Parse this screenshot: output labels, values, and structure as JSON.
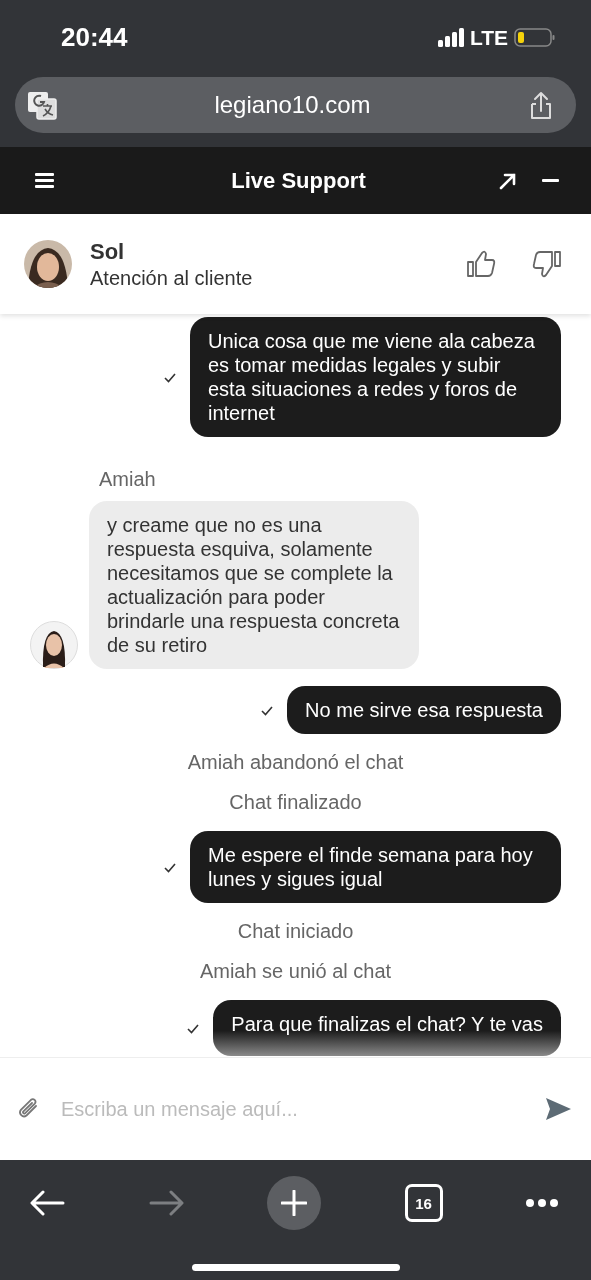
{
  "status_bar": {
    "time": "20:44",
    "network": "LTE"
  },
  "browser": {
    "url": "legiano10.com"
  },
  "chat_header": {
    "title": "Live Support"
  },
  "agent": {
    "name": "Sol",
    "role": "Atención al cliente"
  },
  "messages": [
    {
      "kind": "sent",
      "text": "Unica cosa que me viene ala cabeza es tomar medidas legales y subir esta situaciones a redes y foros de internet"
    },
    {
      "kind": "received",
      "sender": "Amiah",
      "text": "y creame que no es una respuesta esquiva, solamente necesitamos que se complete la actualización para poder brindarle una respuesta concreta de su retiro"
    },
    {
      "kind": "sent",
      "text": "No me sirve esa respuesta"
    },
    {
      "kind": "system",
      "text": "Amiah abandonó el chat"
    },
    {
      "kind": "system",
      "text": "Chat finalizado"
    },
    {
      "kind": "sent",
      "text": "Me espere el finde semana para hoy lunes y sigues igual"
    },
    {
      "kind": "system",
      "text": "Chat iniciado"
    },
    {
      "kind": "system",
      "text": "Amiah se unió al chat"
    },
    {
      "kind": "sent",
      "text": "Para que finalizas el chat? Y te vas"
    }
  ],
  "composer": {
    "placeholder": "Escriba un mensaje aquí..."
  },
  "toolbar": {
    "back_disabled": false,
    "forward_disabled": true,
    "tab_count": "16"
  }
}
